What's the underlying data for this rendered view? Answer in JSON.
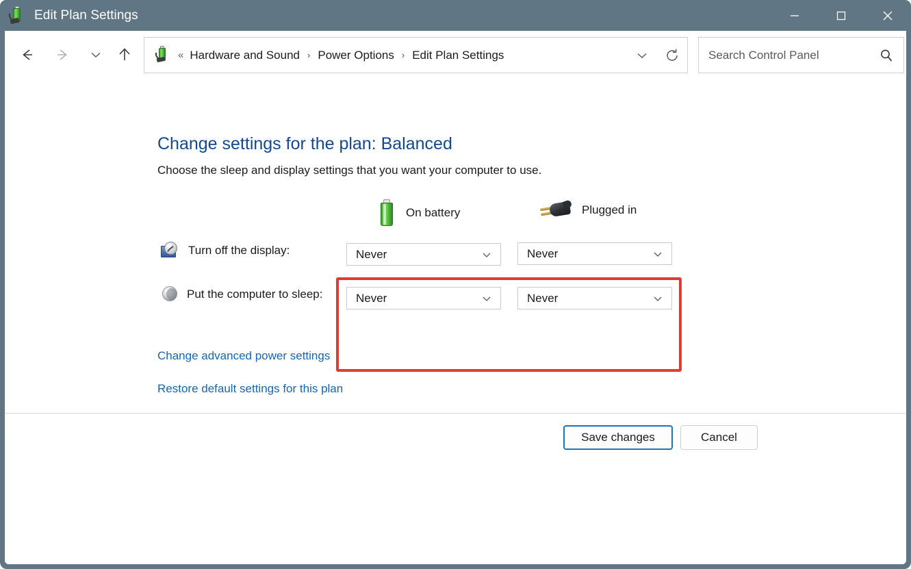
{
  "window": {
    "title": "Edit Plan Settings",
    "title_icon": "battery-plug-icon",
    "controls": {
      "minimize": "minimize-icon",
      "maximize": "maximize-icon",
      "close": "close-icon"
    },
    "colors": {
      "titlebar": "#607684",
      "accent_link": "#1466b5",
      "heading": "#15498f",
      "annotation_red": "#e03b2f",
      "default_button_border": "#1f74b8"
    }
  },
  "navbar": {
    "back_icon": "back-arrow-icon",
    "forward_icon": "forward-arrow-icon",
    "recent_icon": "chevron-down-icon",
    "up_icon": "up-arrow-icon",
    "address_icon": "battery-plug-icon",
    "breadcrumb_prefix": "«",
    "breadcrumb": [
      "Hardware and Sound",
      "Power Options",
      "Edit Plan Settings"
    ],
    "breadcrumb_separator": "›",
    "dropdown_icon": "chevron-down-icon",
    "refresh_icon": "refresh-icon"
  },
  "search": {
    "placeholder": "Search Control Panel",
    "value": "",
    "icon": "search-icon"
  },
  "page": {
    "title": "Change settings for the plan: Balanced",
    "subtitle": "Choose the sleep and display settings that you want your computer to use."
  },
  "columns": [
    {
      "label": "On battery",
      "icon": "battery-icon"
    },
    {
      "label": "Plugged in",
      "icon": "power-plug-icon"
    }
  ],
  "rows": [
    {
      "label": "Turn off the display:",
      "icon": "display-clock-icon",
      "on_battery": "Never",
      "plugged_in": "Never"
    },
    {
      "label": "Put the computer to sleep:",
      "icon": "sleep-moon-icon",
      "on_battery": "Never",
      "plugged_in": "Never"
    }
  ],
  "combo_chevron_icon": "chevron-down-icon",
  "links": [
    "Change advanced power settings",
    "Restore default settings for this plan"
  ],
  "footer": {
    "save_label": "Save changes",
    "cancel_label": "Cancel"
  }
}
